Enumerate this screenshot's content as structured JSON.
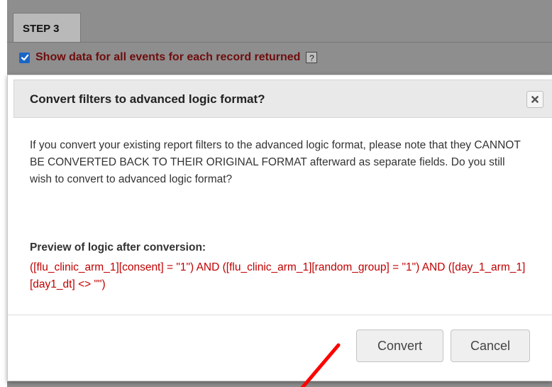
{
  "background": {
    "tab_label": "STEP 3",
    "checkbox_label": "Show data for all events for each record returned",
    "checkbox_checked": true,
    "help_label": "?"
  },
  "dialog": {
    "title": "Convert filters to advanced logic format?",
    "message": "If you convert your existing report filters to the advanced logic format, please note that they CANNOT BE CONVERTED BACK TO THEIR ORIGINAL FORMAT afterward as separate fields. Do you still wish to convert to advanced logic format?",
    "preview_heading": "Preview of logic after conversion:",
    "preview_logic": "([flu_clinic_arm_1][consent] = \"1\") AND ([flu_clinic_arm_1][random_group] = \"1\") AND ([day_1_arm_1][day1_dt] <> \"\")",
    "convert_label": "Convert",
    "cancel_label": "Cancel",
    "close_icon": "close-icon"
  },
  "colors": {
    "accent": "#1a65c6",
    "logic_text": "#c00000",
    "checkbox_label": "#6f0d0d",
    "annotation_arrow": "#ff0000"
  }
}
